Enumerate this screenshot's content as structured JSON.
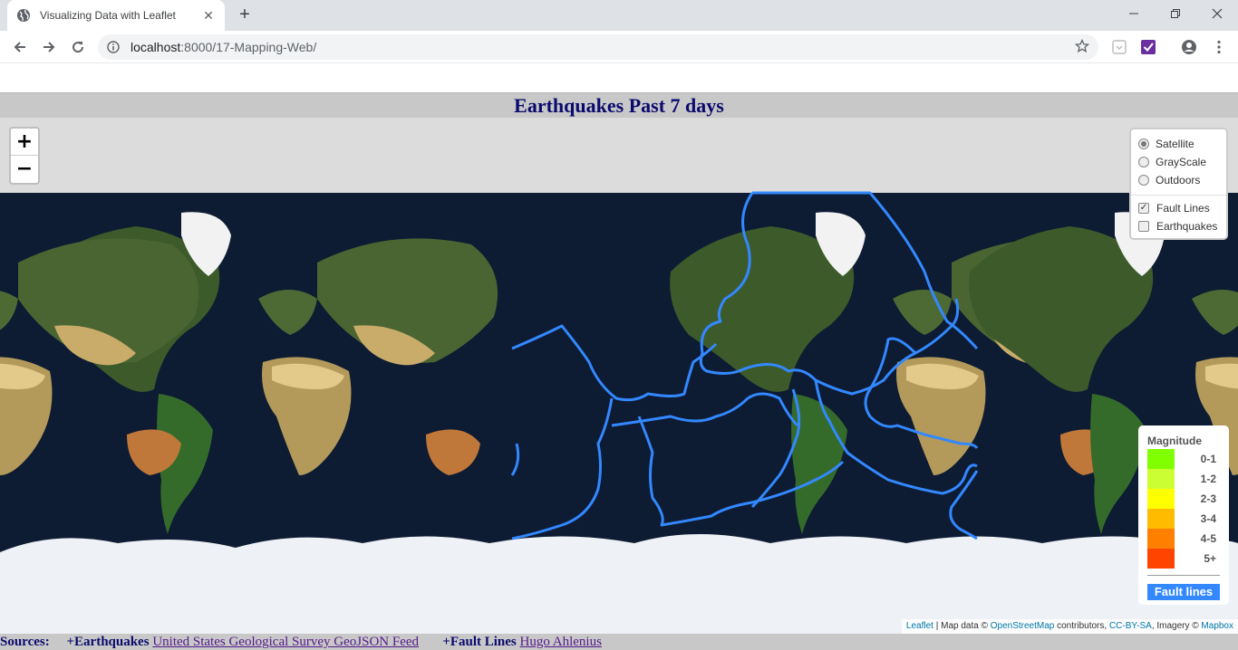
{
  "browser": {
    "tab_title": "Visualizing Data with Leaflet",
    "url_host": "localhost",
    "url_rest": ":8000/17-Mapping-Web/"
  },
  "page": {
    "title": "Earthquakes Past 7 days"
  },
  "map": {
    "zoom_in": "+",
    "zoom_out": "−",
    "base_layers": [
      {
        "label": "Satellite",
        "selected": true
      },
      {
        "label": "GrayScale",
        "selected": false
      },
      {
        "label": "Outdoors",
        "selected": false
      }
    ],
    "overlays": [
      {
        "label": "Fault Lines",
        "checked": true
      },
      {
        "label": "Earthquakes",
        "checked": false
      }
    ],
    "fault_line_color": "#3388ff",
    "legend": {
      "title": "Magnitude",
      "items": [
        {
          "label": "0-1",
          "color": "#80ff00"
        },
        {
          "label": "1-2",
          "color": "#ccff33"
        },
        {
          "label": "2-3",
          "color": "#ffff00"
        },
        {
          "label": "3-4",
          "color": "#ffbb00"
        },
        {
          "label": "4-5",
          "color": "#ff7f00"
        },
        {
          "label": "5+",
          "color": "#ff4400"
        }
      ],
      "fault_label": "Fault lines"
    },
    "attribution": {
      "leaflet": "Leaflet",
      "map_data": " | Map data © ",
      "osm": "OpenStreetMap",
      "contributors": " contributors, ",
      "license": "CC-BY-SA",
      "imagery": ", Imagery © ",
      "mapbox": "Mapbox"
    }
  },
  "footer": {
    "sources_label": "Sources:",
    "eq_label": "+Earthquakes",
    "eq_link": "United States Geological Survey GeoJSON Feed",
    "fault_label": "+Fault Lines",
    "fault_link": "Hugo Ahlenius"
  }
}
